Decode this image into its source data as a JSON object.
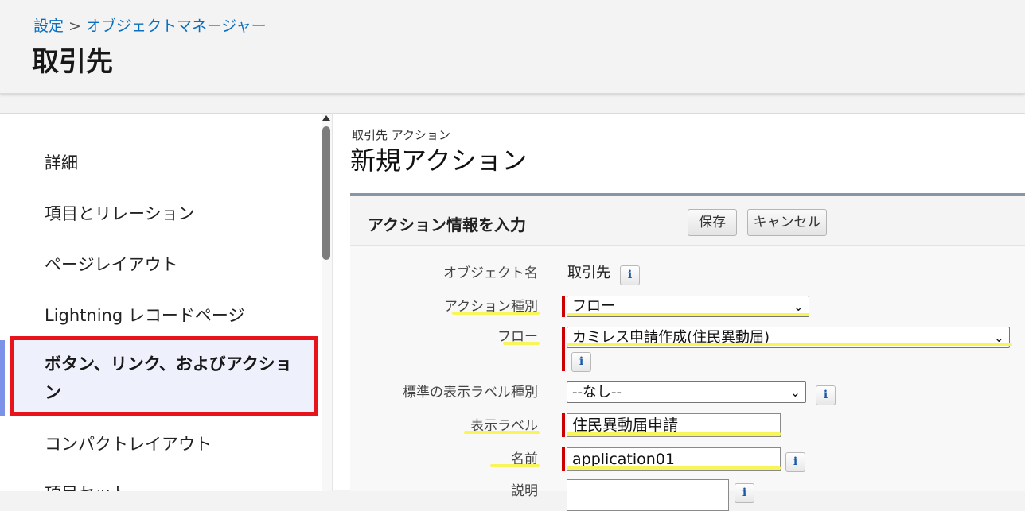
{
  "header": {
    "breadcrumb": {
      "root": "設定",
      "separator": ">",
      "current": "オブジェクトマネージャー"
    },
    "title": "取引先"
  },
  "sidebar": {
    "items": [
      {
        "label": "詳細"
      },
      {
        "label": "項目とリレーション"
      },
      {
        "label": "ページレイアウト"
      },
      {
        "label": "Lightning レコードページ"
      },
      {
        "label": "ボタン、リンク、およびアクション"
      },
      {
        "label": "コンパクトレイアウト"
      },
      {
        "label": "項目セット"
      }
    ],
    "active_label": "ボタン、リンク、およびアクション"
  },
  "main": {
    "subtitle": "取引先 アクション",
    "title": "新規アクション"
  },
  "panel": {
    "title": "アクション情報を入力",
    "save_label": "保存",
    "cancel_label": "キャンセル"
  },
  "form": {
    "object_name": {
      "label": "オブジェクト名",
      "value": "取引先"
    },
    "action_type": {
      "label": "アクション種別",
      "value": "フロー"
    },
    "flow": {
      "label": "フロー",
      "value": "カミレス申請作成(住民異動届)"
    },
    "standard_label_type": {
      "label": "標準の表示ラベル種別",
      "value": "--なし--"
    },
    "display_label": {
      "label": "表示ラベル",
      "value": "住民異動届申請"
    },
    "name": {
      "label": "名前",
      "value": "application01"
    },
    "description": {
      "label": "説明",
      "value": ""
    }
  },
  "icons": {
    "info": "i",
    "chevron": "⌄"
  },
  "colors": {
    "link": "#0b6fbf",
    "highlight_box": "#e8141c",
    "required": "#cc0000",
    "annotation_highlight": "#f7f55a"
  }
}
